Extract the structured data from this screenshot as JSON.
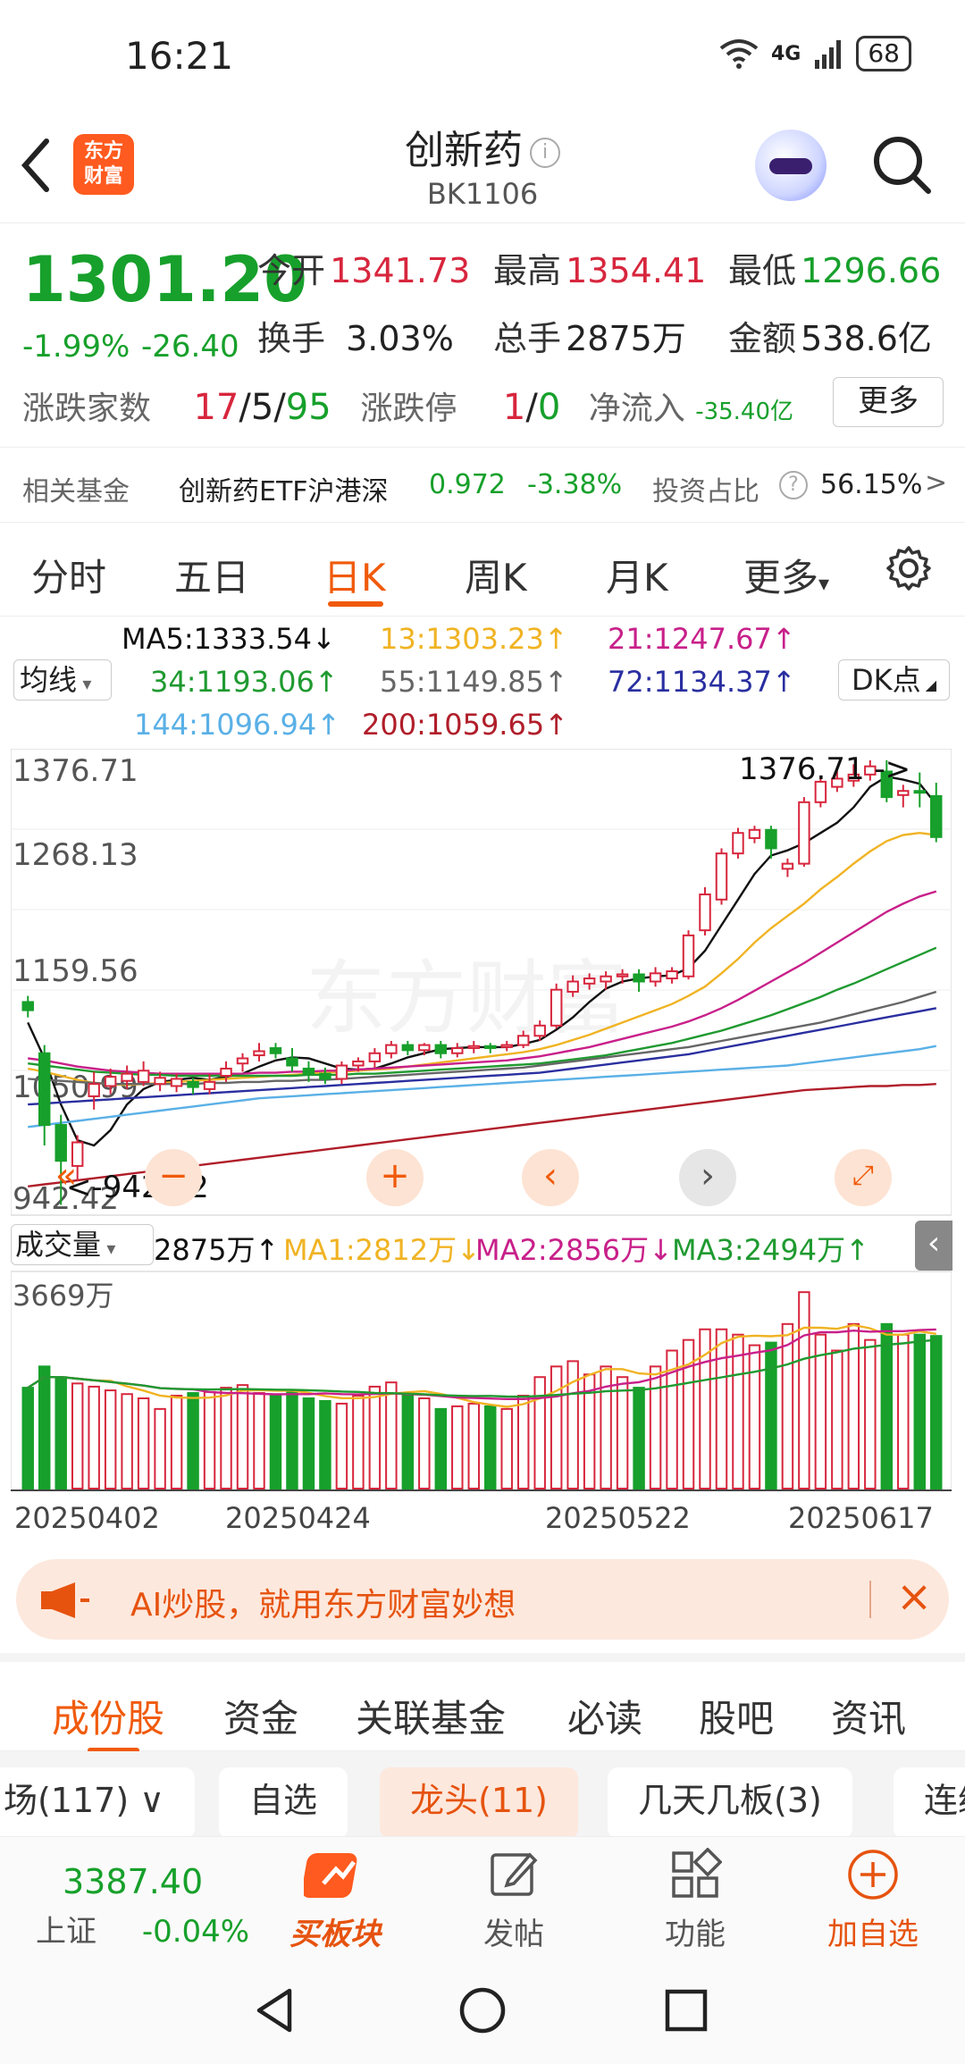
{
  "status_bar": {
    "time": "16:21",
    "network": "4G",
    "battery": "68"
  },
  "header": {
    "logo_text_line1": "东方",
    "logo_text_line2": "财富",
    "title": "创新药",
    "code": "BK1106"
  },
  "quote": {
    "price": "1301.20",
    "pct_change": "-1.99%",
    "change": "-26.40",
    "open_label": "今开",
    "open": "1341.73",
    "high_label": "最高",
    "high": "1354.41",
    "low_label": "最低",
    "low": "1296.66",
    "turnover_label": "换手",
    "turnover": "3.03%",
    "volume_label": "总手",
    "volume": "2875万",
    "amount_label": "金额",
    "amount": "538.6亿",
    "updown_label": "涨跌家数",
    "up": "17",
    "flat": "5",
    "down": "95",
    "limit_label": "涨跌停",
    "limit_up": "1",
    "limit_down": "0",
    "netflow_label": "净流入",
    "netflow": "-35.40亿",
    "more_label": "更多"
  },
  "fund": {
    "label": "相关基金",
    "name": "创新药ETF沪港深",
    "price": "0.972",
    "pct": "-3.38%",
    "ratio_label": "投资占比",
    "ratio": "56.15%",
    "arrow": ">"
  },
  "chart_tabs": [
    "分时",
    "五日",
    "日K",
    "周K",
    "月K",
    "更多"
  ],
  "ma": {
    "selector": "均线",
    "ma5": "MA5:1333.54↓",
    "ma13": "13:1303.23↑",
    "ma21": "21:1247.67↑",
    "ma34": "34:1193.06↑",
    "ma55": "55:1149.85↑",
    "ma72": "72:1134.37↑",
    "ma144": "144:1096.94↑",
    "ma200": "200:1059.65↑",
    "dk_label": "DK点"
  },
  "colors": {
    "up": "#d7263d",
    "down": "#17a02b",
    "accent": "#f05a0a",
    "ma5": "#111111",
    "ma13": "#f0b323",
    "ma21": "#c8208a",
    "ma34": "#1f9a30",
    "ma55": "#666666",
    "ma72": "#2a2fa0",
    "ma144": "#5ab0e6",
    "ma200": "#b01e2a"
  },
  "volume_legend": {
    "selector": "成交量",
    "vol": "2875万↑",
    "ma1": "MA1:2812万↓",
    "ma2": "MA2:2856万↓",
    "ma3": "MA3:2494万↑"
  },
  "chart_data": {
    "type": "candlestick",
    "price_axis_ticks": [
      "1376.71",
      "1268.13",
      "1159.56",
      "1050.99",
      "942.42"
    ],
    "ylim": [
      942.42,
      1376.71
    ],
    "max_label": "1376.71",
    "min_label": "942.42",
    "volume_axis_label": "3669万",
    "volume_ylim": [
      0,
      3669
    ],
    "date_ticks": [
      "20250402",
      "20250424",
      "20250522",
      "20250617"
    ],
    "candles": [
      {
        "o": 1140,
        "c": 1132,
        "h": 1146,
        "l": 1125
      },
      {
        "o": 1090,
        "c": 1020,
        "h": 1098,
        "l": 1000
      },
      {
        "o": 1020,
        "c": 985,
        "h": 1030,
        "l": 942
      },
      {
        "o": 980,
        "c": 1003,
        "h": 1010,
        "l": 965
      },
      {
        "o": 1048,
        "c": 1060,
        "h": 1072,
        "l": 1035
      },
      {
        "o": 1058,
        "c": 1067,
        "h": 1075,
        "l": 1050
      },
      {
        "o": 1063,
        "c": 1070,
        "h": 1078,
        "l": 1055
      },
      {
        "o": 1062,
        "c": 1073,
        "h": 1082,
        "l": 1058
      },
      {
        "o": 1060,
        "c": 1066,
        "h": 1072,
        "l": 1053
      },
      {
        "o": 1058,
        "c": 1065,
        "h": 1070,
        "l": 1052
      },
      {
        "o": 1062,
        "c": 1057,
        "h": 1066,
        "l": 1050
      },
      {
        "o": 1055,
        "c": 1062,
        "h": 1070,
        "l": 1050
      },
      {
        "o": 1068,
        "c": 1075,
        "h": 1082,
        "l": 1062
      },
      {
        "o": 1080,
        "c": 1085,
        "h": 1090,
        "l": 1072
      },
      {
        "o": 1088,
        "c": 1092,
        "h": 1100,
        "l": 1082
      },
      {
        "o": 1095,
        "c": 1090,
        "h": 1100,
        "l": 1085
      },
      {
        "o": 1085,
        "c": 1078,
        "h": 1095,
        "l": 1072
      },
      {
        "o": 1075,
        "c": 1070,
        "h": 1082,
        "l": 1062
      },
      {
        "o": 1070,
        "c": 1065,
        "h": 1076,
        "l": 1060
      },
      {
        "o": 1065,
        "c": 1078,
        "h": 1082,
        "l": 1060
      },
      {
        "o": 1078,
        "c": 1082,
        "h": 1086,
        "l": 1072
      },
      {
        "o": 1082,
        "c": 1090,
        "h": 1095,
        "l": 1076
      },
      {
        "o": 1090,
        "c": 1098,
        "h": 1102,
        "l": 1085
      },
      {
        "o": 1098,
        "c": 1093,
        "h": 1102,
        "l": 1088
      },
      {
        "o": 1093,
        "c": 1098,
        "h": 1100,
        "l": 1088
      },
      {
        "o": 1098,
        "c": 1090,
        "h": 1102,
        "l": 1085
      },
      {
        "o": 1090,
        "c": 1095,
        "h": 1100,
        "l": 1086
      },
      {
        "o": 1095,
        "c": 1097,
        "h": 1102,
        "l": 1090
      },
      {
        "o": 1097,
        "c": 1095,
        "h": 1100,
        "l": 1090
      },
      {
        "o": 1096,
        "c": 1098,
        "h": 1102,
        "l": 1092
      },
      {
        "o": 1098,
        "c": 1107,
        "h": 1112,
        "l": 1095
      },
      {
        "o": 1107,
        "c": 1117,
        "h": 1122,
        "l": 1102
      },
      {
        "o": 1117,
        "c": 1152,
        "h": 1158,
        "l": 1114
      },
      {
        "o": 1150,
        "c": 1160,
        "h": 1166,
        "l": 1145
      },
      {
        "o": 1158,
        "c": 1163,
        "h": 1168,
        "l": 1152
      },
      {
        "o": 1160,
        "c": 1165,
        "h": 1170,
        "l": 1152
      },
      {
        "o": 1165,
        "c": 1167,
        "h": 1172,
        "l": 1158
      },
      {
        "o": 1167,
        "c": 1160,
        "h": 1172,
        "l": 1150
      },
      {
        "o": 1160,
        "c": 1168,
        "h": 1174,
        "l": 1155
      },
      {
        "o": 1163,
        "c": 1170,
        "h": 1174,
        "l": 1158
      },
      {
        "o": 1165,
        "c": 1205,
        "h": 1210,
        "l": 1162
      },
      {
        "o": 1210,
        "c": 1245,
        "h": 1252,
        "l": 1205
      },
      {
        "o": 1240,
        "c": 1285,
        "h": 1290,
        "l": 1235
      },
      {
        "o": 1285,
        "c": 1305,
        "h": 1310,
        "l": 1280
      },
      {
        "o": 1300,
        "c": 1308,
        "h": 1312,
        "l": 1295
      },
      {
        "o": 1308,
        "c": 1290,
        "h": 1312,
        "l": 1280
      },
      {
        "o": 1270,
        "c": 1275,
        "h": 1280,
        "l": 1262
      },
      {
        "o": 1275,
        "c": 1335,
        "h": 1340,
        "l": 1272
      },
      {
        "o": 1335,
        "c": 1355,
        "h": 1360,
        "l": 1330
      },
      {
        "o": 1350,
        "c": 1358,
        "h": 1366,
        "l": 1345
      },
      {
        "o": 1356,
        "c": 1362,
        "h": 1372,
        "l": 1350
      },
      {
        "o": 1362,
        "c": 1370,
        "h": 1376,
        "l": 1356
      },
      {
        "o": 1365,
        "c": 1340,
        "h": 1376,
        "l": 1335
      },
      {
        "o": 1342,
        "c": 1346,
        "h": 1352,
        "l": 1330
      },
      {
        "o": 1346,
        "c": 1345,
        "h": 1364,
        "l": 1330
      },
      {
        "o": 1341,
        "c": 1301,
        "h": 1354,
        "l": 1296
      }
    ],
    "volume": [
      1900,
      2300,
      2100,
      1980,
      1920,
      1850,
      1780,
      1700,
      1500,
      1750,
      1800,
      1820,
      1900,
      1950,
      1800,
      1750,
      1820,
      1700,
      1650,
      1600,
      1750,
      1920,
      2000,
      1800,
      1700,
      1500,
      1550,
      1600,
      1550,
      1500,
      1750,
      2100,
      2300,
      2400,
      2150,
      2300,
      2100,
      1900,
      2300,
      2600,
      2800,
      3000,
      3000,
      2900,
      2700,
      2750,
      3100,
      3700,
      2900,
      2600,
      3100,
      2800,
      3100,
      2900,
      2900,
      2875
    ],
    "series": [
      {
        "name": "MA5",
        "values": [
          1120,
          1085,
          1040,
          1005,
          1000,
          1015,
          1040,
          1055,
          1062,
          1064,
          1066,
          1064,
          1067,
          1070,
          1077,
          1083,
          1086,
          1085,
          1080,
          1075,
          1074,
          1075,
          1080,
          1086,
          1090,
          1094,
          1095,
          1096,
          1096,
          1096,
          1099,
          1103,
          1113,
          1125,
          1140,
          1153,
          1160,
          1163,
          1165,
          1166,
          1173,
          1190,
          1215,
          1240,
          1265,
          1283,
          1288,
          1295,
          1305,
          1315,
          1330,
          1350,
          1360,
          1357,
          1353,
          1333
        ]
      },
      {
        "name": "MA13",
        "values": [
          1075,
          1072,
          1068,
          1064,
          1061,
          1060,
          1059,
          1060,
          1061,
          1062,
          1063,
          1064,
          1065,
          1066,
          1067,
          1068,
          1069,
          1070,
          1071,
          1072,
          1073,
          1074,
          1075,
          1077,
          1079,
          1081,
          1083,
          1085,
          1087,
          1089,
          1091,
          1094,
          1098,
          1103,
          1108,
          1114,
          1120,
          1126,
          1132,
          1138,
          1146,
          1155,
          1168,
          1182,
          1198,
          1212,
          1224,
          1236,
          1250,
          1262,
          1275,
          1287,
          1297,
          1303,
          1305,
          1303
        ]
      },
      {
        "name": "MA21",
        "values": [
          1085,
          1083,
          1080,
          1077,
          1075,
          1073,
          1072,
          1071,
          1070,
          1070,
          1070,
          1070,
          1070,
          1070,
          1071,
          1071,
          1072,
          1072,
          1073,
          1073,
          1074,
          1075,
          1076,
          1077,
          1078,
          1079,
          1080,
          1081,
          1082,
          1083,
          1085,
          1087,
          1090,
          1093,
          1096,
          1100,
          1104,
          1108,
          1112,
          1116,
          1121,
          1127,
          1134,
          1142,
          1151,
          1160,
          1169,
          1178,
          1188,
          1198,
          1208,
          1218,
          1228,
          1236,
          1243,
          1248
        ]
      },
      {
        "name": "MA34",
        "values": [
          1080,
          1078,
          1076,
          1074,
          1072,
          1071,
          1070,
          1069,
          1069,
          1068,
          1068,
          1068,
          1068,
          1068,
          1068,
          1068,
          1068,
          1069,
          1069,
          1069,
          1070,
          1070,
          1071,
          1072,
          1073,
          1074,
          1075,
          1076,
          1077,
          1078,
          1079,
          1080,
          1082,
          1084,
          1086,
          1088,
          1091,
          1094,
          1097,
          1100,
          1104,
          1108,
          1112,
          1117,
          1122,
          1127,
          1133,
          1139,
          1145,
          1152,
          1158,
          1165,
          1172,
          1179,
          1186,
          1193
        ]
      },
      {
        "name": "MA55",
        "values": [
          1065,
          1064,
          1063,
          1062,
          1061,
          1060,
          1060,
          1060,
          1060,
          1060,
          1060,
          1061,
          1061,
          1062,
          1062,
          1063,
          1063,
          1064,
          1064,
          1065,
          1066,
          1067,
          1068,
          1069,
          1070,
          1071,
          1072,
          1073,
          1074,
          1075,
          1076,
          1078,
          1080,
          1082,
          1084,
          1086,
          1088,
          1090,
          1092,
          1094,
          1096,
          1099,
          1102,
          1105,
          1108,
          1111,
          1114,
          1117,
          1120,
          1124,
          1128,
          1132,
          1136,
          1140,
          1145,
          1150
        ]
      },
      {
        "name": "MA72",
        "values": [
          1040,
          1041,
          1042,
          1043,
          1044,
          1045,
          1046,
          1047,
          1048,
          1049,
          1050,
          1051,
          1052,
          1053,
          1054,
          1055,
          1056,
          1057,
          1058,
          1059,
          1060,
          1061,
          1062,
          1063,
          1064,
          1065,
          1066,
          1067,
          1068,
          1069,
          1070,
          1071,
          1073,
          1075,
          1077,
          1079,
          1081,
          1083,
          1085,
          1087,
          1089,
          1092,
          1095,
          1098,
          1101,
          1104,
          1107,
          1110,
          1113,
          1116,
          1119,
          1122,
          1125,
          1128,
          1131,
          1134
        ]
      },
      {
        "name": "MA144",
        "values": [
          1018,
          1020,
          1022,
          1024,
          1026,
          1028,
          1030,
          1032,
          1034,
          1036,
          1038,
          1040,
          1042,
          1044,
          1046,
          1047,
          1048,
          1049,
          1050,
          1051,
          1052,
          1053,
          1054,
          1055,
          1056,
          1057,
          1058,
          1059,
          1060,
          1061,
          1062,
          1063,
          1064,
          1065,
          1066,
          1067,
          1068,
          1069,
          1070,
          1071,
          1072,
          1073,
          1074,
          1075,
          1076,
          1077,
          1078,
          1080,
          1082,
          1084,
          1086,
          1088,
          1090,
          1092,
          1094,
          1097
        ]
      },
      {
        "name": "MA200",
        "values": [
          960,
          962,
          964,
          966,
          968,
          970,
          972,
          974,
          976,
          978,
          980,
          982,
          984,
          986,
          988,
          990,
          992,
          994,
          996,
          998,
          1000,
          1002,
          1004,
          1006,
          1008,
          1010,
          1012,
          1014,
          1016,
          1018,
          1020,
          1022,
          1024,
          1026,
          1028,
          1030,
          1032,
          1034,
          1036,
          1038,
          1040,
          1042,
          1044,
          1046,
          1048,
          1050,
          1052,
          1054,
          1055,
          1056,
          1057,
          1058,
          1058,
          1059,
          1059,
          1060
        ]
      }
    ]
  },
  "banner": {
    "text": "AI炒股，就用东方财富妙想"
  },
  "bottom_tabs": [
    "成份股",
    "资金",
    "关联基金",
    "必读",
    "股吧",
    "资讯"
  ],
  "filter_chips": [
    "场(117)",
    "自选",
    "龙头(11)",
    "几天几板(3)",
    "连续"
  ],
  "bottom_nav": {
    "index_value": "3387.40",
    "index_name": "上证",
    "index_pct": "-0.04%",
    "buy_label": "买板块",
    "post_label": "发帖",
    "func_label": "功能",
    "add_label": "加自选"
  }
}
